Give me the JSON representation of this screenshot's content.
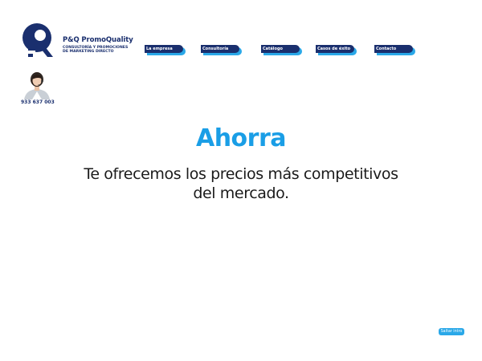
{
  "brand": {
    "name": "P&Q PromoQuality",
    "tagline_line1": "CONSULTORÍA Y PROMOCIONES",
    "tagline_line2": "DE MARKETING DIRECTO"
  },
  "nav": {
    "items": [
      {
        "label": "La empresa"
      },
      {
        "label": "Consultoría"
      },
      {
        "label": "Catálogo"
      },
      {
        "label": "Casos de éxito"
      },
      {
        "label": "Contacto"
      }
    ]
  },
  "contact": {
    "phone": "933 637 003"
  },
  "hero": {
    "title": "Ahorra",
    "text_line1": "Te ofrecemos los precios más competitivos",
    "text_line2": "del mercado."
  },
  "skip_intro": {
    "label": "Saltar intro"
  },
  "colors": {
    "navy": "#1a2f6e",
    "accent_blue": "#1a9ee6",
    "light_blue": "#2aa8e8"
  },
  "icons": {
    "logo": "pq-logo-mark",
    "avatar": "headset-agent-avatar"
  }
}
